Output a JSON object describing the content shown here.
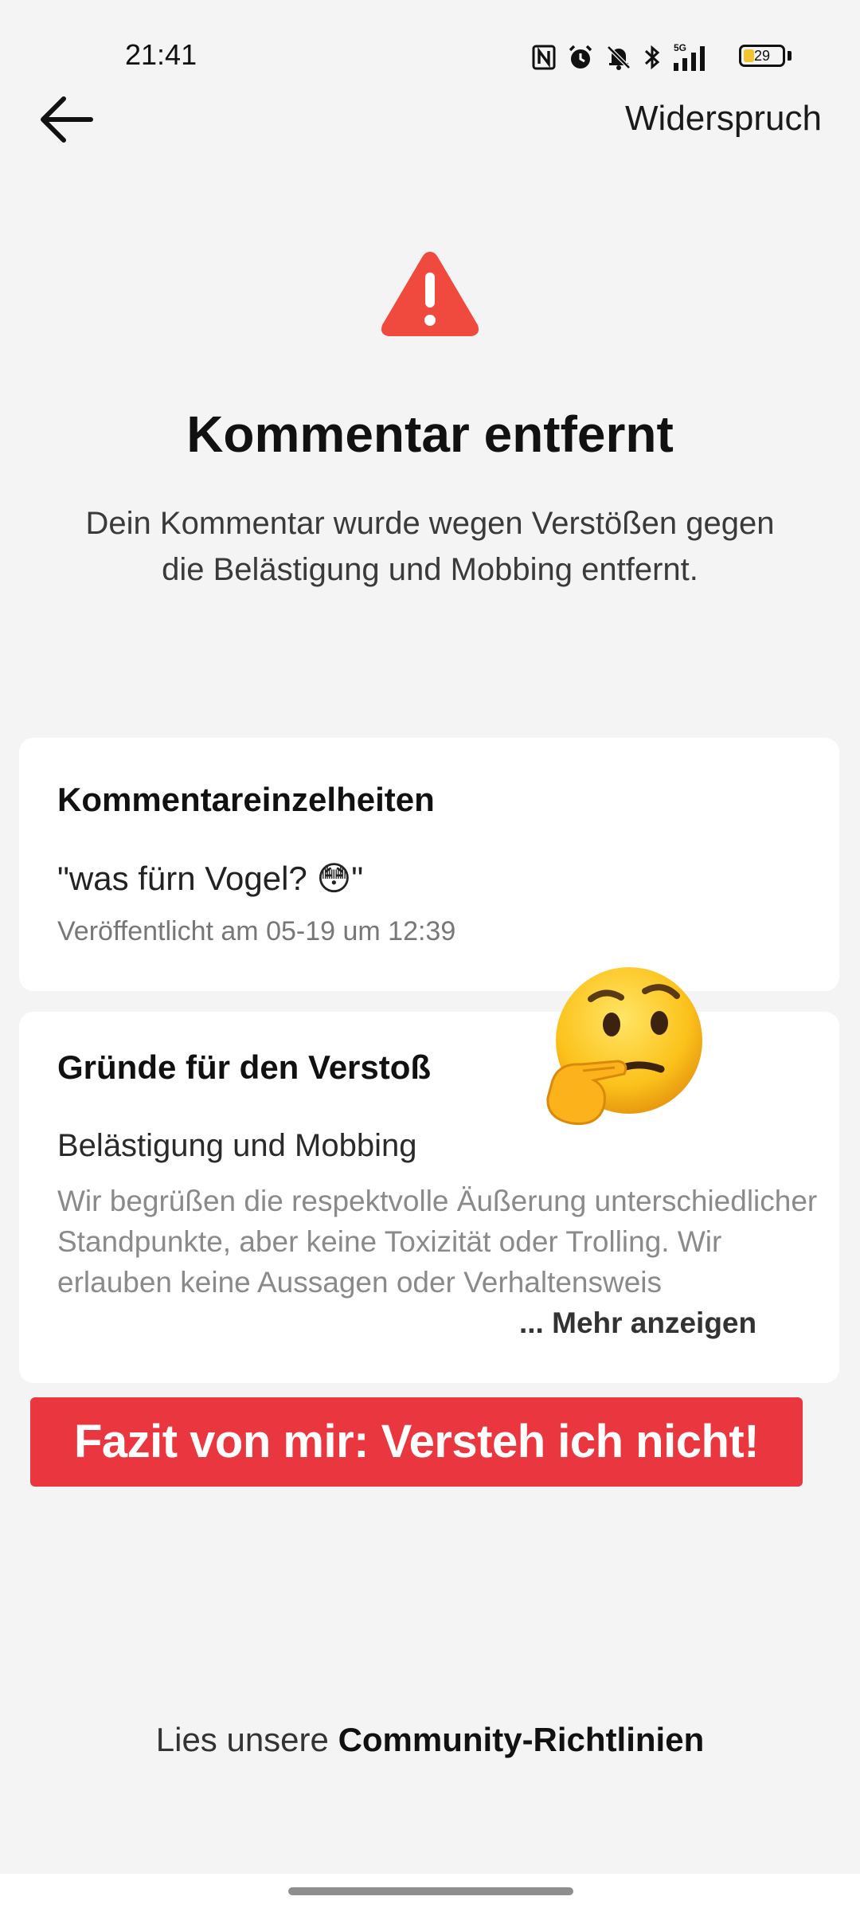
{
  "status_bar": {
    "time": "21:41",
    "network": "5G",
    "battery": "29",
    "battery_level": 0.29,
    "icons": [
      "nfc-icon",
      "alarm-icon",
      "silent-bell-icon",
      "bluetooth-icon",
      "signal-icon",
      "battery-icon"
    ]
  },
  "header": {
    "back_icon": "arrow-left-icon",
    "appeal_label": "Widerspruch"
  },
  "notice": {
    "icon": "warning-triangle-icon",
    "title": "Kommentar entfernt",
    "description": "Dein Kommentar wurde wegen Verstößen gegen die Belästigung und Mobbing entfernt."
  },
  "details_card": {
    "heading": "Kommentareinzelheiten",
    "comment_text": "\"was fürn Vogel? 😳\"",
    "published": "Veröffentlicht am 05-19 um 12:39"
  },
  "reasons_card": {
    "heading": "Gründe für den Verstoß",
    "reason_title": "Belästigung und Mobbing",
    "reason_text": "Wir begrüßen die respektvolle Äußerung unterschiedlicher Standpunkte, aber keine Toxizität oder Trolling. Wir erlauben keine Aussagen oder Verhaltensweis",
    "more_label": "... Mehr anzeigen"
  },
  "overlay": {
    "emoji": "thinking-face-emoji",
    "banner_text": "Fazit von mir: Versteh ich nicht!",
    "banner_color": "#e9363f"
  },
  "footer": {
    "prefix": "Lies unsere ",
    "link": "Community-Richtlinien"
  },
  "colors": {
    "background": "#f4f4f4",
    "warning": "#f04a3e",
    "card": "#ffffff"
  }
}
